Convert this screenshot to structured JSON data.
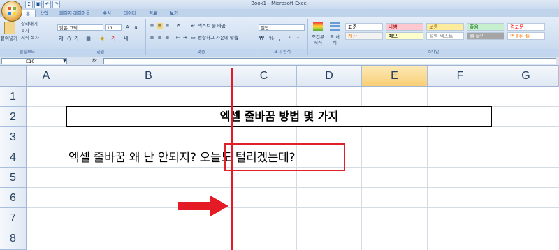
{
  "window": {
    "title": "Book1 - Microsoft Excel",
    "qat_icons": [
      "sigma-icon",
      "save-icon",
      "undo-icon",
      "redo-icon"
    ],
    "qat_glyphs": [
      "Σ",
      "▣",
      "↶",
      "↷"
    ]
  },
  "ribbon": {
    "tabs": [
      "홈",
      "삽입",
      "페이지 레이아웃",
      "수식",
      "데이터",
      "검토",
      "보기"
    ],
    "active_tab": "홈",
    "clipboard": {
      "paste": "붙여넣기",
      "cut": "잘라내기",
      "copy": "복사",
      "format_painter": "서식 복사",
      "label": "클립보드"
    },
    "font": {
      "name": "맑은 고딕",
      "size": "11",
      "label": "글꼴"
    },
    "alignment": {
      "wrap_text": "텍스트 줄 바꿈",
      "merge_center": "병합하고 가운데 맞춤",
      "label": "맞춤"
    },
    "number": {
      "format": "일반",
      "label": "표시 형식"
    },
    "styles": {
      "conditional": "조건부 서식",
      "table": "표 서식",
      "label": "스타일",
      "cells": [
        {
          "name": "표준",
          "bg": "#ffffff",
          "fg": "#000000"
        },
        {
          "name": "나쁨",
          "bg": "#ffc7ce",
          "fg": "#9c0006"
        },
        {
          "name": "보통",
          "bg": "#ffeb9c",
          "fg": "#9c6500"
        },
        {
          "name": "좋음",
          "bg": "#c6efce",
          "fg": "#006100"
        },
        {
          "name": "경고문",
          "bg": "#ffffff",
          "fg": "#ff0000"
        },
        {
          "name": "계산",
          "bg": "#f2f2f2",
          "fg": "#fa7d00"
        },
        {
          "name": "메모",
          "bg": "#ffffcc",
          "fg": "#000000"
        },
        {
          "name": "설명 텍스트",
          "bg": "#ffffff",
          "fg": "#7f7f7f"
        },
        {
          "name": "셀 확인",
          "bg": "#a5a5a5",
          "fg": "#ffffff"
        },
        {
          "name": "연결된 셀",
          "bg": "#ffffff",
          "fg": "#fa7d00"
        }
      ]
    }
  },
  "formula_bar": {
    "name_box": "E10",
    "fx": "fx",
    "value": ""
  },
  "columns": [
    "A",
    "B",
    "C",
    "D",
    "E",
    "F",
    "G"
  ],
  "selected_column": "E",
  "rows": [
    "1",
    "2",
    "3",
    "4",
    "5",
    "6",
    "7",
    "8"
  ],
  "cells": {
    "B2": "엑셀 줄바꿈 방법 몇 가지",
    "B4": "엑셀 줄바꿈 왜 난 안되지? 오늘도 털리겠는데?"
  },
  "annotations": {
    "accent": "#e41b24"
  }
}
